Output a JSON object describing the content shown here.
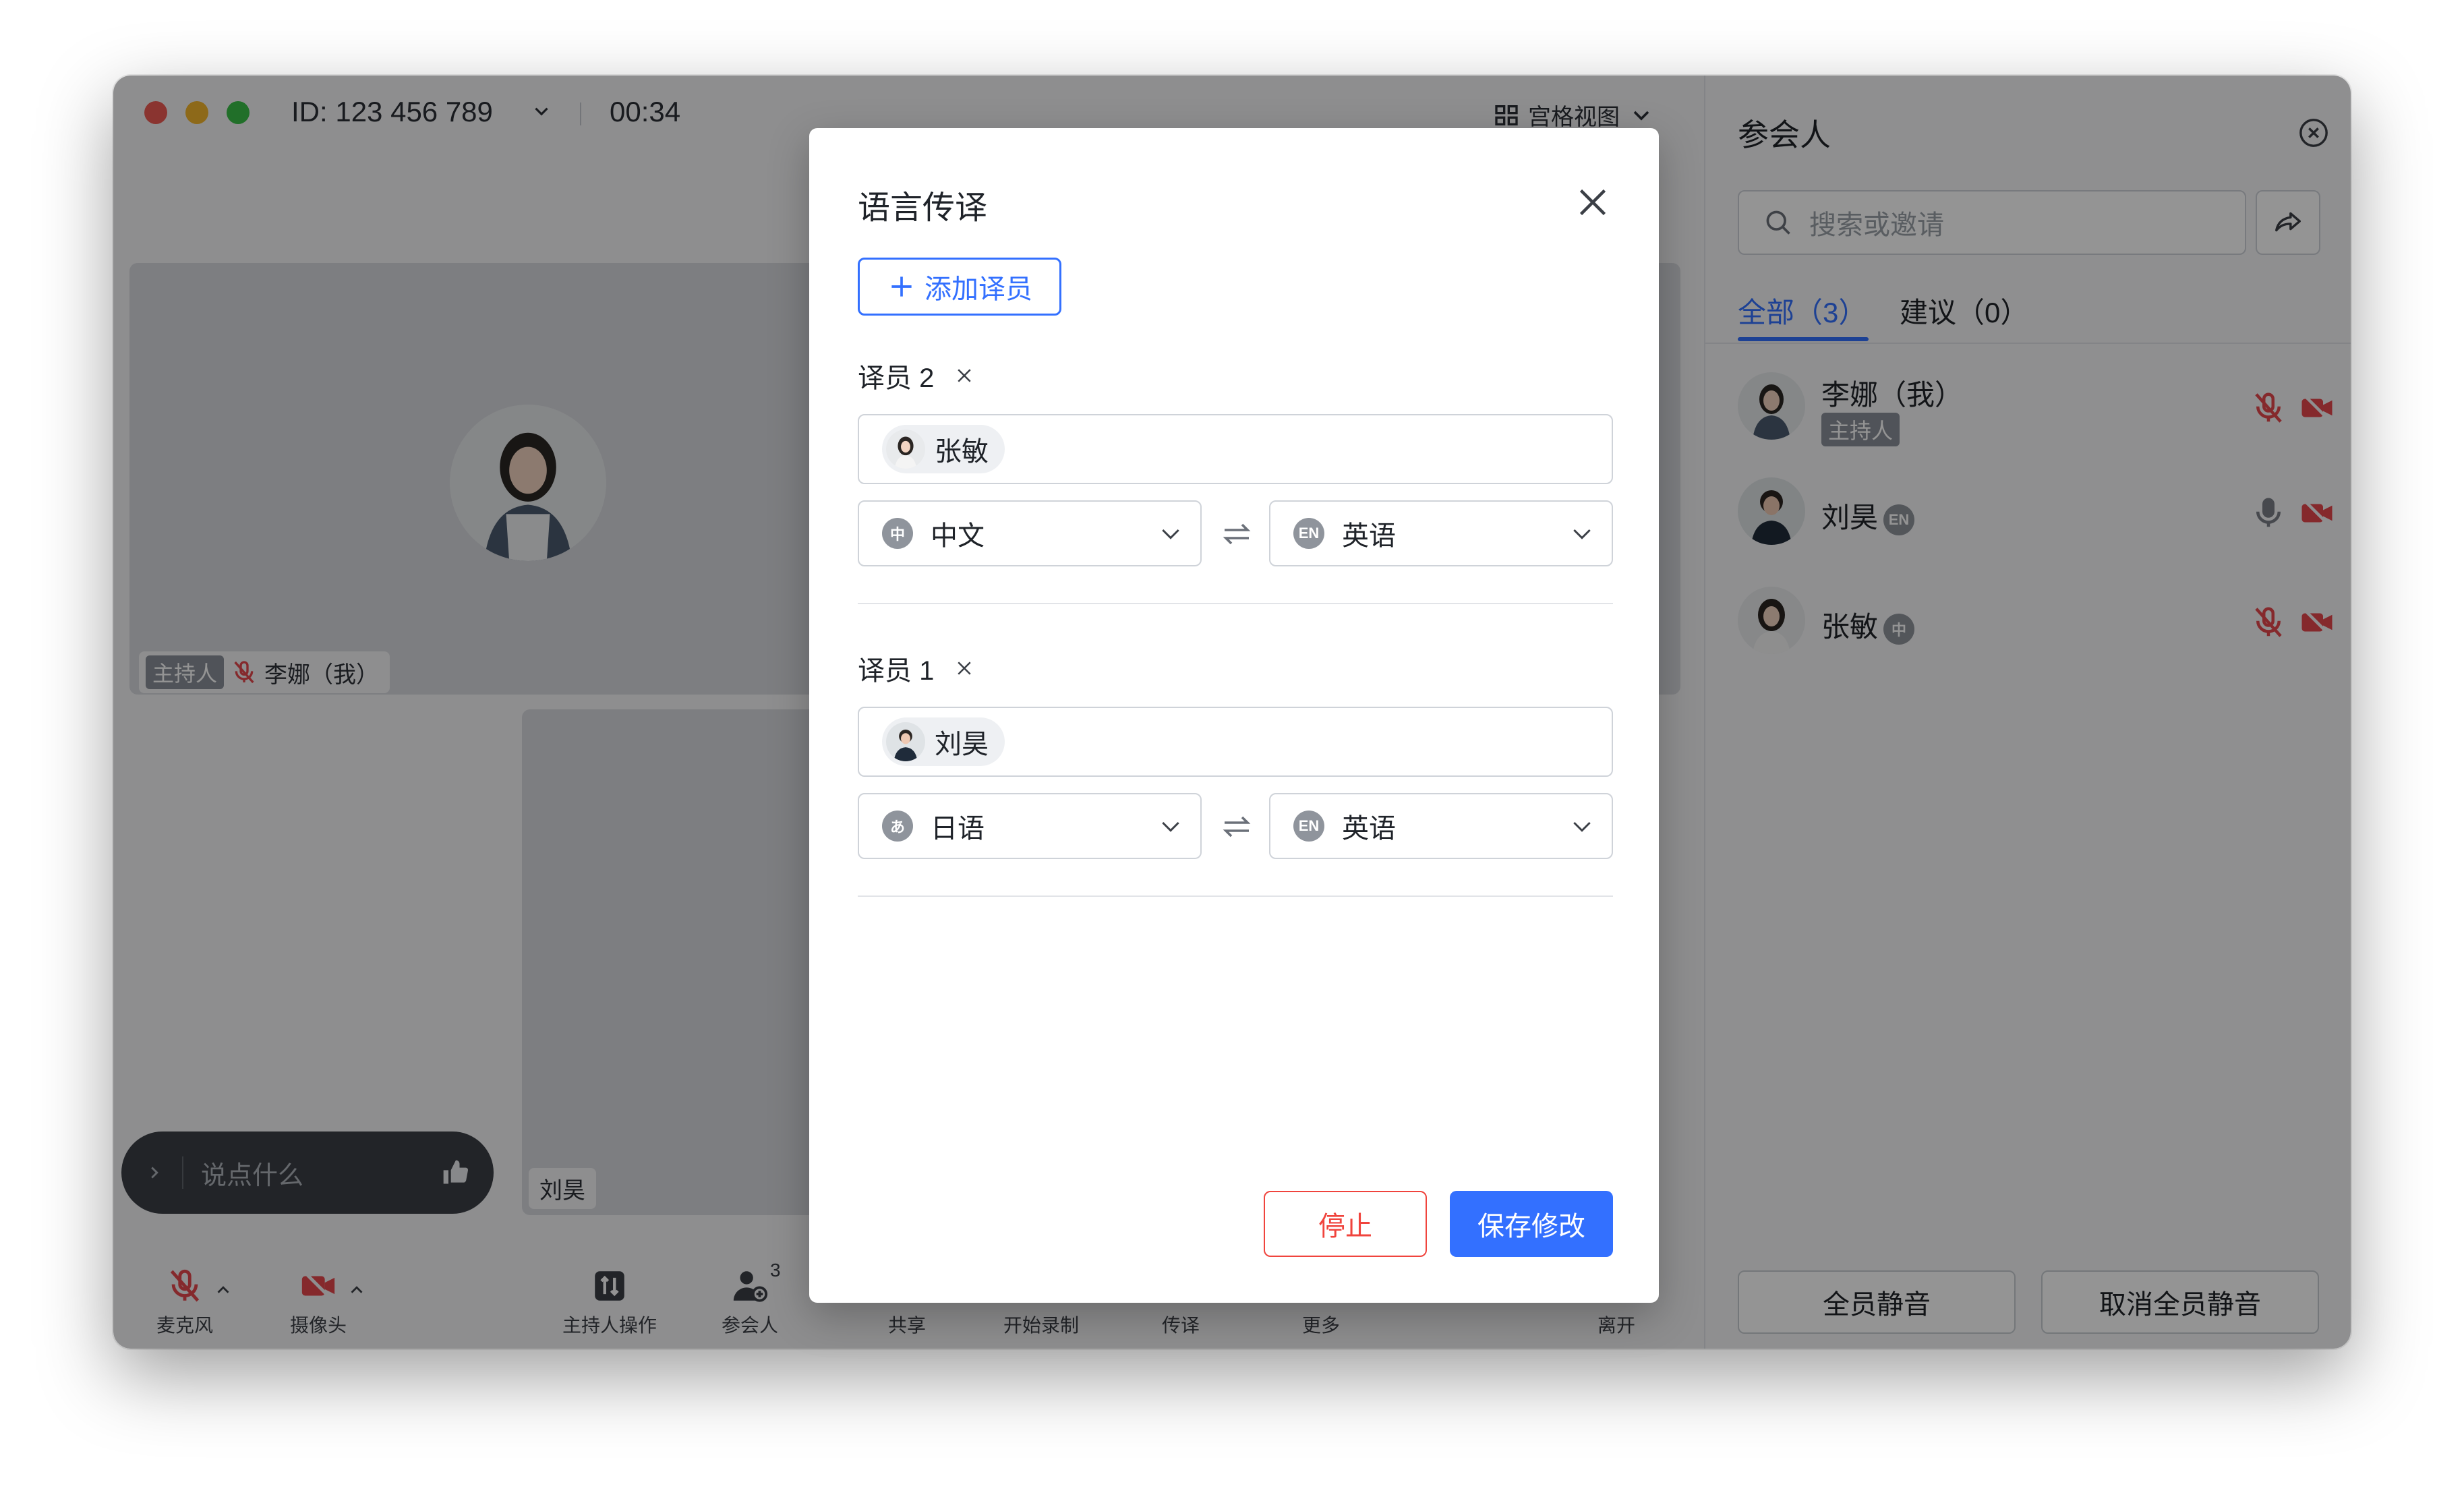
{
  "window": {
    "meeting_id": "ID: 123 456 789",
    "timer": "00:34",
    "view_mode": "宫格视图"
  },
  "video": {
    "host_tag": "主持人",
    "main_name": "李娜（我）",
    "second_name": "刘昊",
    "chat_placeholder": "说点什么"
  },
  "toolbar": {
    "mic": "麦克风",
    "camera": "摄像头",
    "host_ops": "主持人操作",
    "participants": "参会人",
    "participants_count": "3",
    "share": "共享",
    "record": "开始录制",
    "interpret": "传译",
    "more": "更多",
    "leave": "离开"
  },
  "panel": {
    "title": "参会人",
    "search_placeholder": "搜索或邀请",
    "tab_all": "全部（3）",
    "tab_suggested": "建议（0）",
    "people": [
      {
        "name": "李娜（我）",
        "badge": "主持人",
        "lang": ""
      },
      {
        "name": "刘昊",
        "badge": "",
        "lang": "EN"
      },
      {
        "name": "张敏",
        "badge": "",
        "lang": "中"
      }
    ],
    "mute_all": "全员静音",
    "unmute_all": "取消全员静音"
  },
  "dialog": {
    "title": "语言传译",
    "add_button": "添加译员",
    "interpreters": [
      {
        "label": "译员 2",
        "person": "张敏",
        "from_icon": "中",
        "from": "中文",
        "to_icon": "EN",
        "to": "英语"
      },
      {
        "label": "译员 1",
        "person": "刘昊",
        "from_icon": "あ",
        "from": "日语",
        "to_icon": "EN",
        "to": "英语"
      }
    ],
    "stop": "停止",
    "save": "保存修改"
  },
  "colors": {
    "accent": "#3370ff",
    "danger": "#f0443d",
    "muted_red": "#e5484d"
  }
}
